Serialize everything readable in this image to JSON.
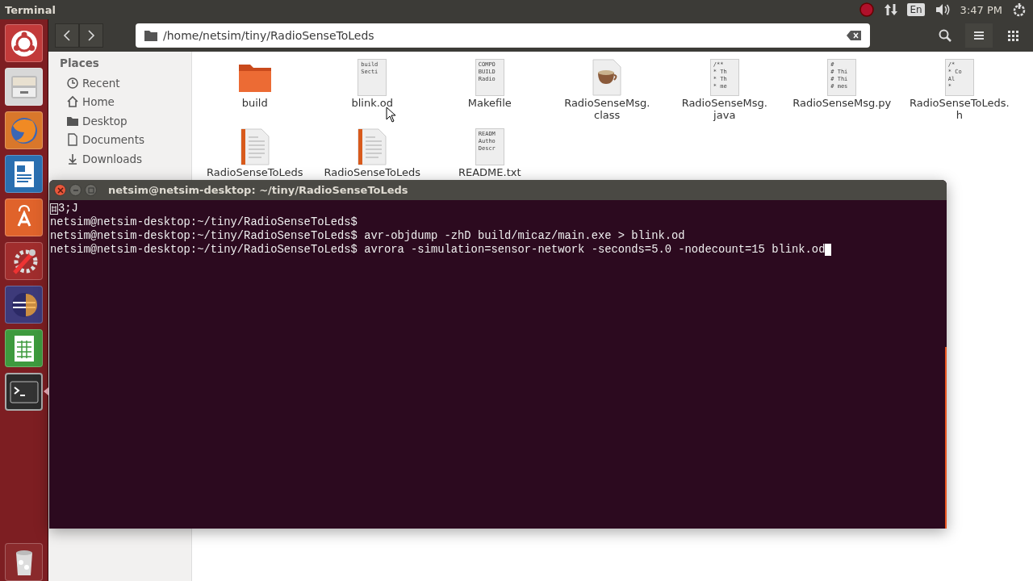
{
  "top_bar": {
    "title": "Terminal",
    "keyboard": "En",
    "clock": "3:47 PM"
  },
  "launcher": [
    {
      "kind": "ubuntu",
      "focused": false
    },
    {
      "kind": "files",
      "focused": false
    },
    {
      "kind": "browser",
      "focused": false
    },
    {
      "kind": "writer",
      "focused": false
    },
    {
      "kind": "software",
      "focused": false
    },
    {
      "kind": "settings",
      "focused": false
    },
    {
      "kind": "eclipse",
      "focused": false
    },
    {
      "kind": "calc",
      "focused": false
    },
    {
      "kind": "terminal",
      "focused": true
    },
    {
      "kind": "trash",
      "focused": false
    }
  ],
  "file_manager": {
    "path": "/home/netsim/tiny/RadioSenseToLeds",
    "sidebar": {
      "heading": "Places",
      "items": [
        {
          "kind": "recent",
          "label": "Recent"
        },
        {
          "kind": "home",
          "label": "Home"
        },
        {
          "kind": "folder",
          "label": "Desktop"
        },
        {
          "kind": "doc",
          "label": "Documents"
        },
        {
          "kind": "download",
          "label": "Downloads"
        }
      ]
    },
    "files": [
      {
        "kind": "folder",
        "label_lines": [
          "build"
        ]
      },
      {
        "kind": "text",
        "preview": [
          "build",
          "Secti"
        ],
        "label_lines": [
          "blink.od"
        ]
      },
      {
        "kind": "text",
        "preview": [
          "COMPO",
          "BUILD",
          "Radio"
        ],
        "label_lines": [
          "Makefile"
        ]
      },
      {
        "kind": "java",
        "label_lines": [
          "RadioSenseMsg.",
          "class"
        ]
      },
      {
        "kind": "text",
        "preview": [
          "/**",
          "* Th",
          "* Th",
          "* me"
        ],
        "label_lines": [
          "RadioSenseMsg.",
          "java"
        ]
      },
      {
        "kind": "text",
        "preview": [
          "#",
          "# Thi",
          "# Thi",
          "# mes"
        ],
        "label_lines": [
          "RadioSenseMsg.py"
        ]
      },
      {
        "kind": "text",
        "preview": [
          "/*",
          "* Co",
          "Al",
          "*"
        ],
        "label_lines": [
          "RadioSenseToLeds.",
          "h"
        ]
      },
      {
        "kind": "source",
        "label_lines": [
          "RadioSenseToLeds"
        ]
      },
      {
        "kind": "source",
        "label_lines": [
          "RadioSenseToLeds"
        ]
      },
      {
        "kind": "text",
        "preview": [
          "READM",
          "Autho",
          "Descr"
        ],
        "label_lines": [
          "README.txt"
        ]
      }
    ]
  },
  "terminal": {
    "title": "netsim@netsim-desktop: ~/tiny/RadioSenseToLeds",
    "lines": [
      {
        "kind": "glyph",
        "text": "3;J"
      },
      {
        "kind": "plain",
        "text": "netsim@netsim-desktop:~/tiny/RadioSenseToLeds$"
      },
      {
        "kind": "plain",
        "text": "netsim@netsim-desktop:~/tiny/RadioSenseToLeds$ avr-objdump -zhD build/micaz/main.exe > blink.od"
      },
      {
        "kind": "cursor",
        "text": "netsim@netsim-desktop:~/tiny/RadioSenseToLeds$ avrora -simulation=sensor-network -seconds=5.0 -nodecount=15 blink.od"
      }
    ]
  }
}
